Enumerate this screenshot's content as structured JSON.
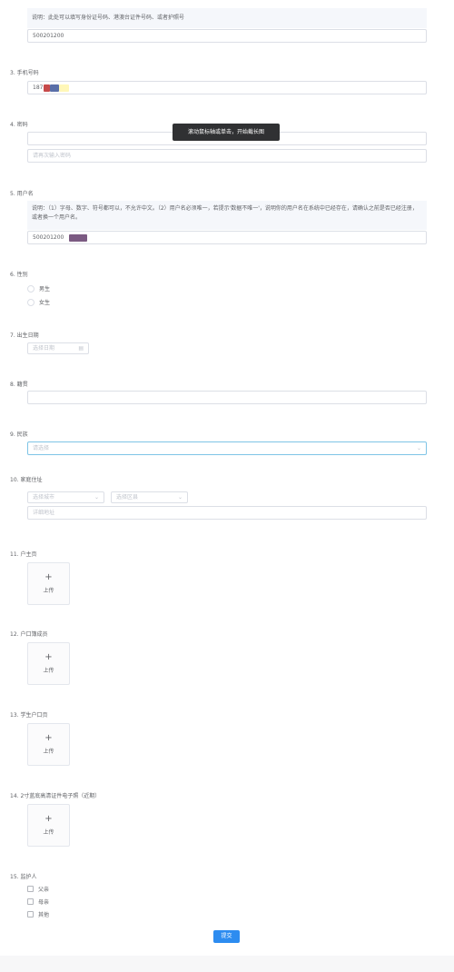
{
  "id_section": {
    "note": "说明：此处可以填写身份证号码、港澳台证件号码、或者护照号",
    "value": "500201200"
  },
  "phone": {
    "label": "3. 手机号码",
    "value": "187"
  },
  "password": {
    "label": "4. 密码",
    "confirm_placeholder": "请再次输入密码"
  },
  "tooltip": "滚动鼠标轴或单击，开始截长图",
  "username": {
    "label": "5. 用户名",
    "note": "说明：（1）字母、数字、符号都可以，不允许中文。（2）用户名必须唯一，若提示'数据不唯一'，说明你的用户名在系统中已经存在，请确认之前是否已经注册，或者换一个用户名。",
    "value": "500201200"
  },
  "gender": {
    "label": "6. 性别",
    "options": [
      "男生",
      "女生"
    ]
  },
  "birthday": {
    "label": "7. 出生日期",
    "placeholder": "选择日期"
  },
  "hometown": {
    "label": "8. 籍贯"
  },
  "ethnicity": {
    "label": "9. 民族",
    "placeholder": "请选择"
  },
  "address": {
    "label": "10. 家庭住址",
    "city_placeholder": "选择城市",
    "district_placeholder": "选择区县",
    "detail_placeholder": "详细地址"
  },
  "uploads": [
    {
      "label": "11. 户主页",
      "button": "上传"
    },
    {
      "label": "12. 户口簿成员",
      "button": "上传"
    },
    {
      "label": "13. 学生户口页",
      "button": "上传"
    },
    {
      "label": "14. 2寸蓝底高清证件电子照（近期）",
      "button": "上传"
    }
  ],
  "guardian": {
    "label": "15. 监护人",
    "options": [
      "父亲",
      "母亲",
      "其他"
    ]
  },
  "submit_label": "提交",
  "colors": {
    "accent": "#2d8cf0",
    "note_bg": "#f5f7fb",
    "border": "#dcdfe6",
    "redact_red": "#c74a4a",
    "redact_blue": "#5a6fa8",
    "redact_purple": "#7b5a82",
    "highlight_yellow": "#fff7b8"
  }
}
